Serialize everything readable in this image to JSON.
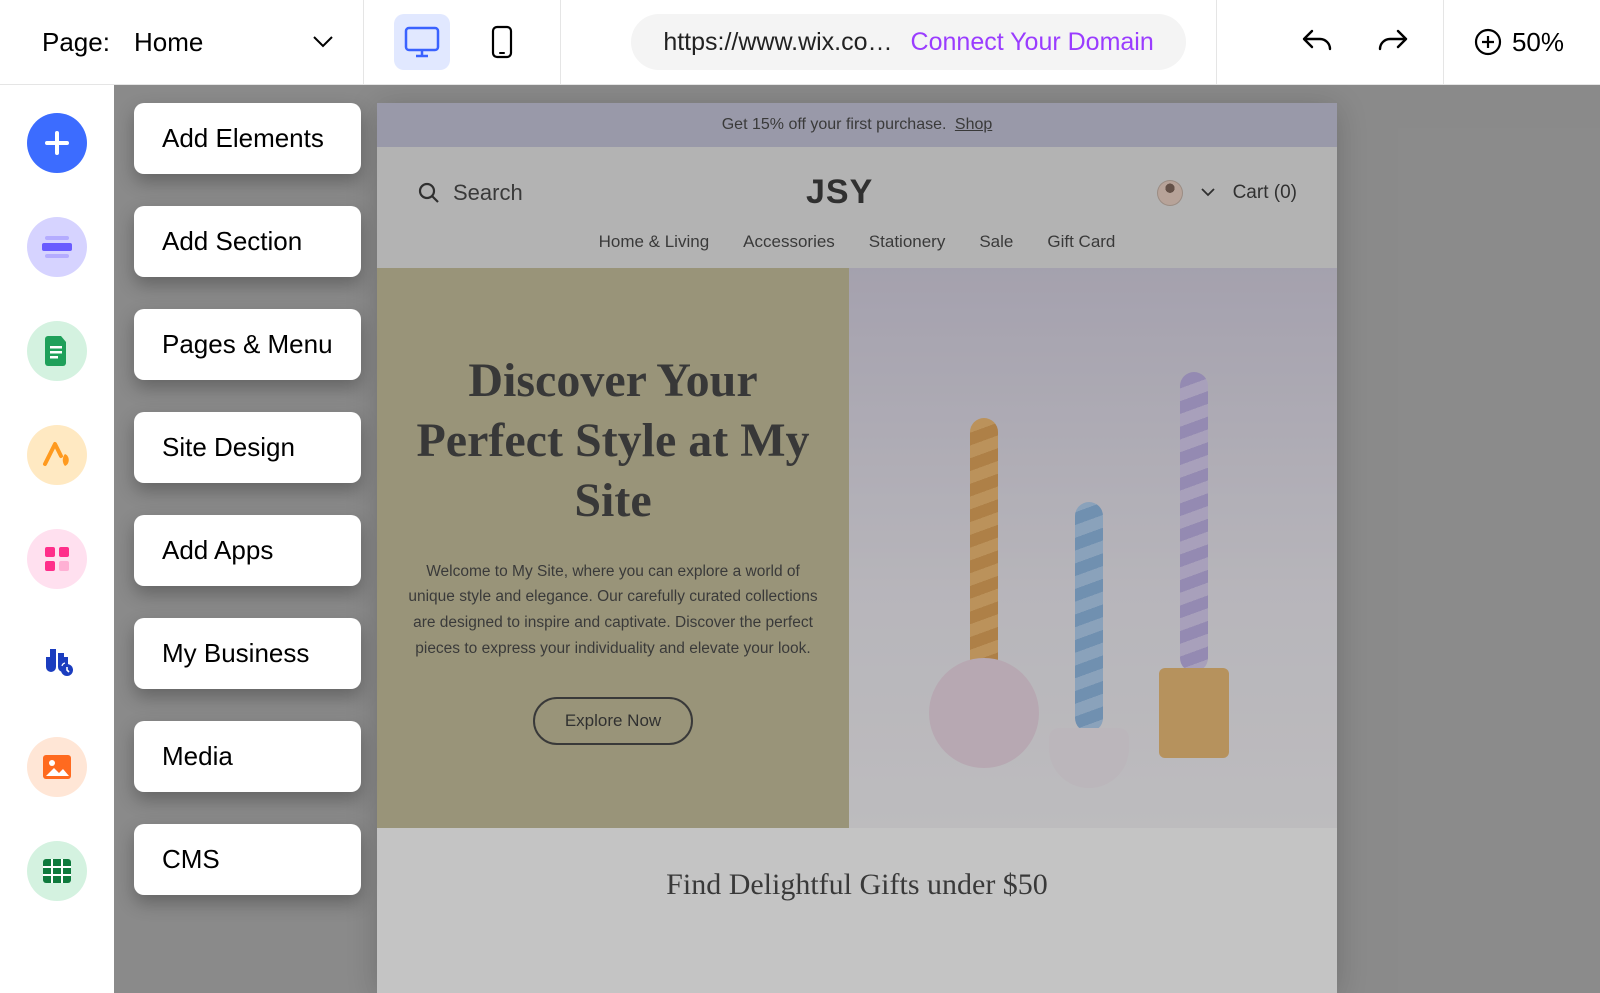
{
  "topbar": {
    "page_label": "Page:",
    "page_value": "Home",
    "url": "https://www.wix.co…",
    "connect_domain": "Connect Your Domain",
    "zoom": "50%"
  },
  "sidebar_tooltips": [
    "Add Elements",
    "Add Section",
    "Pages & Menu",
    "Site Design",
    "Add Apps",
    "My Business",
    "Media",
    "CMS"
  ],
  "preview": {
    "banner_text": "Get 15% off your first purchase.",
    "banner_link": "Shop",
    "search_label": "Search",
    "logo": "JSY",
    "cart_label": "Cart (0)",
    "nav": [
      "Home & Living",
      "Accessories",
      "Stationery",
      "Sale",
      "Gift Card"
    ],
    "hero_title": "Discover Your Perfect Style at My Site",
    "hero_sub": "Welcome to My Site, where you can explore a world of unique style and elegance. Our carefully curated collections are designed to inspire and captivate. Discover the perfect pieces to express your individuality and elevate your look.",
    "hero_button": "Explore Now",
    "section2_title": "Find Delightful Gifts under $50"
  }
}
